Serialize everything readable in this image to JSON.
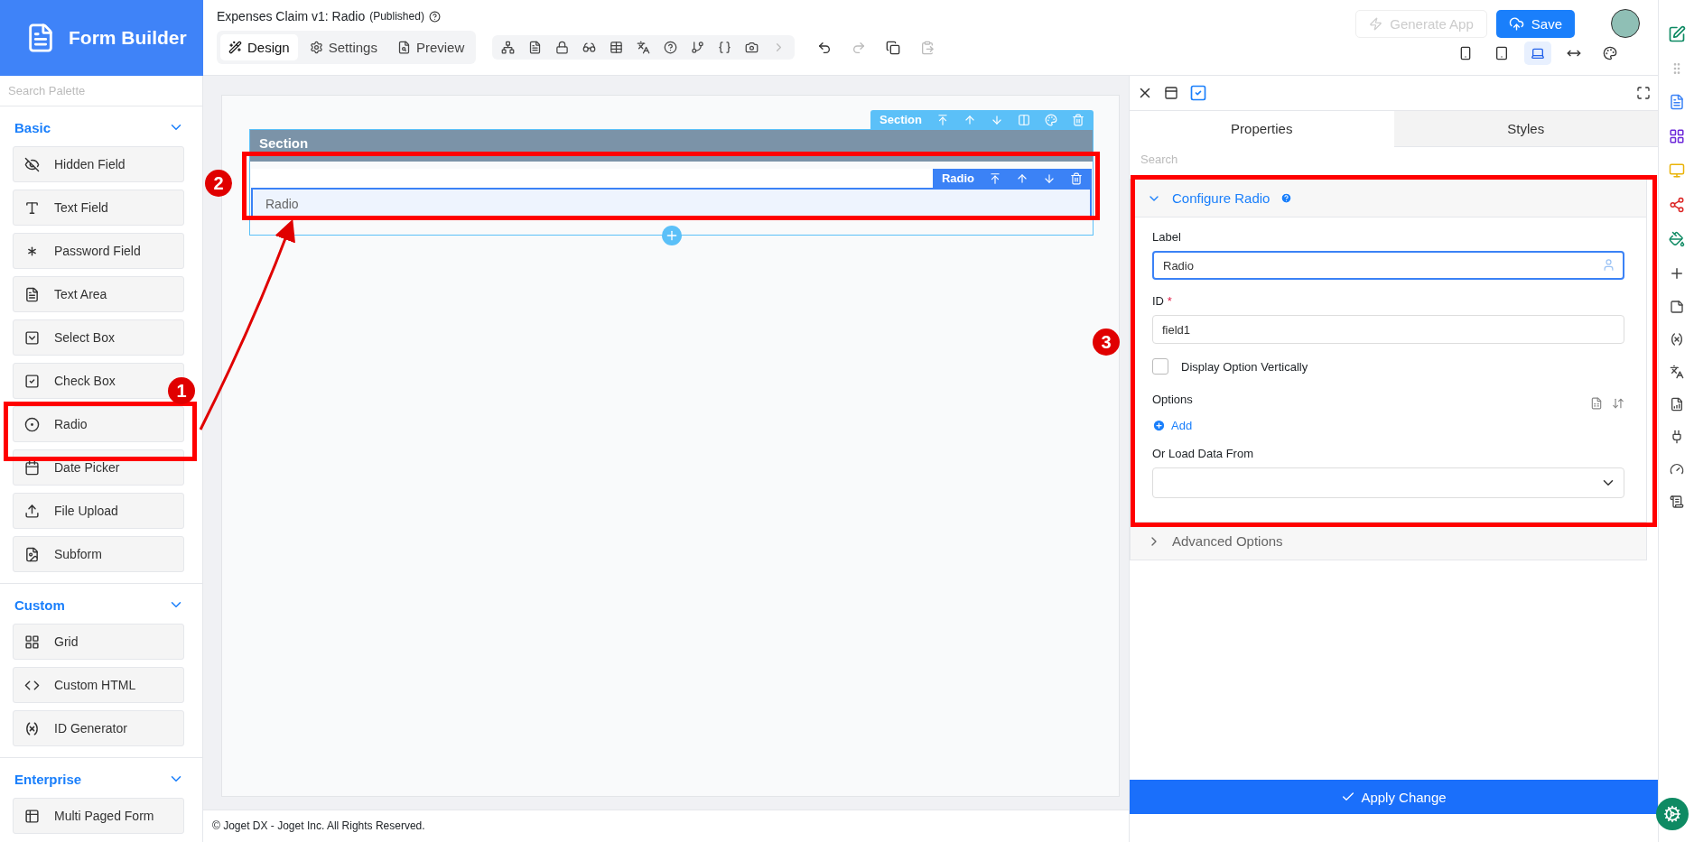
{
  "app": {
    "title": "Form Builder"
  },
  "header": {
    "form_title": "Expenses Claim v1: Radio",
    "status": "(Published)",
    "tabs": [
      {
        "label": "Design",
        "selected": true
      },
      {
        "label": "Settings",
        "selected": false
      },
      {
        "label": "Preview",
        "selected": false
      }
    ],
    "generate_button": "Generate App",
    "save_button": "Save",
    "device_views": [
      {
        "kind": "phone",
        "selected": false
      },
      {
        "kind": "tablet",
        "selected": false
      },
      {
        "kind": "laptop",
        "selected": true
      },
      {
        "kind": "wide",
        "selected": false
      }
    ]
  },
  "palette": {
    "search_placeholder": "Search Palette",
    "groups": [
      {
        "title": "Basic",
        "expanded": true,
        "items": [
          {
            "label": "Hidden Field",
            "kind": "hidden"
          },
          {
            "label": "Text Field",
            "kind": "text"
          },
          {
            "label": "Password Field",
            "kind": "password"
          },
          {
            "label": "Text Area",
            "kind": "textarea"
          },
          {
            "label": "Select Box",
            "kind": "select"
          },
          {
            "label": "Check Box",
            "kind": "checkbox"
          },
          {
            "label": "Radio",
            "kind": "radio"
          },
          {
            "label": "Date Picker",
            "kind": "date"
          },
          {
            "label": "File Upload",
            "kind": "upload"
          },
          {
            "label": "Subform",
            "kind": "subform"
          }
        ]
      },
      {
        "title": "Custom",
        "expanded": true,
        "items": [
          {
            "label": "Grid",
            "kind": "grid"
          },
          {
            "label": "Custom HTML",
            "kind": "html"
          },
          {
            "label": "ID Generator",
            "kind": "id"
          }
        ]
      },
      {
        "title": "Enterprise",
        "expanded": true,
        "items": [
          {
            "label": "Multi Paged Form",
            "kind": "multipage"
          }
        ]
      }
    ]
  },
  "canvas": {
    "section_toolbar_label": "Section",
    "section_title": "Section",
    "field_toolbar_label": "Radio",
    "field_label": "Radio"
  },
  "properties": {
    "tabs": [
      {
        "label": "Properties",
        "selected": true
      },
      {
        "label": "Styles",
        "selected": false
      }
    ],
    "search_placeholder": "Search",
    "configure": {
      "title": "Configure Radio",
      "expanded": true,
      "label_label": "Label",
      "label_value": "Radio",
      "id_label": "ID",
      "id_required_mark": "*",
      "id_value": "field1",
      "vertical": {
        "label": "Display Option Vertically",
        "checked": false
      },
      "options_label": "Options",
      "add_label": "Add",
      "load_label": "Or Load Data From"
    },
    "advanced": {
      "title": "Advanced Options",
      "expanded": false
    },
    "apply_button": "Apply Change"
  },
  "footer": "© Joget DX - Joget Inc. All Rights Reserved.",
  "annotations": [
    {
      "number": "1"
    },
    {
      "number": "2"
    },
    {
      "number": "3"
    }
  ]
}
